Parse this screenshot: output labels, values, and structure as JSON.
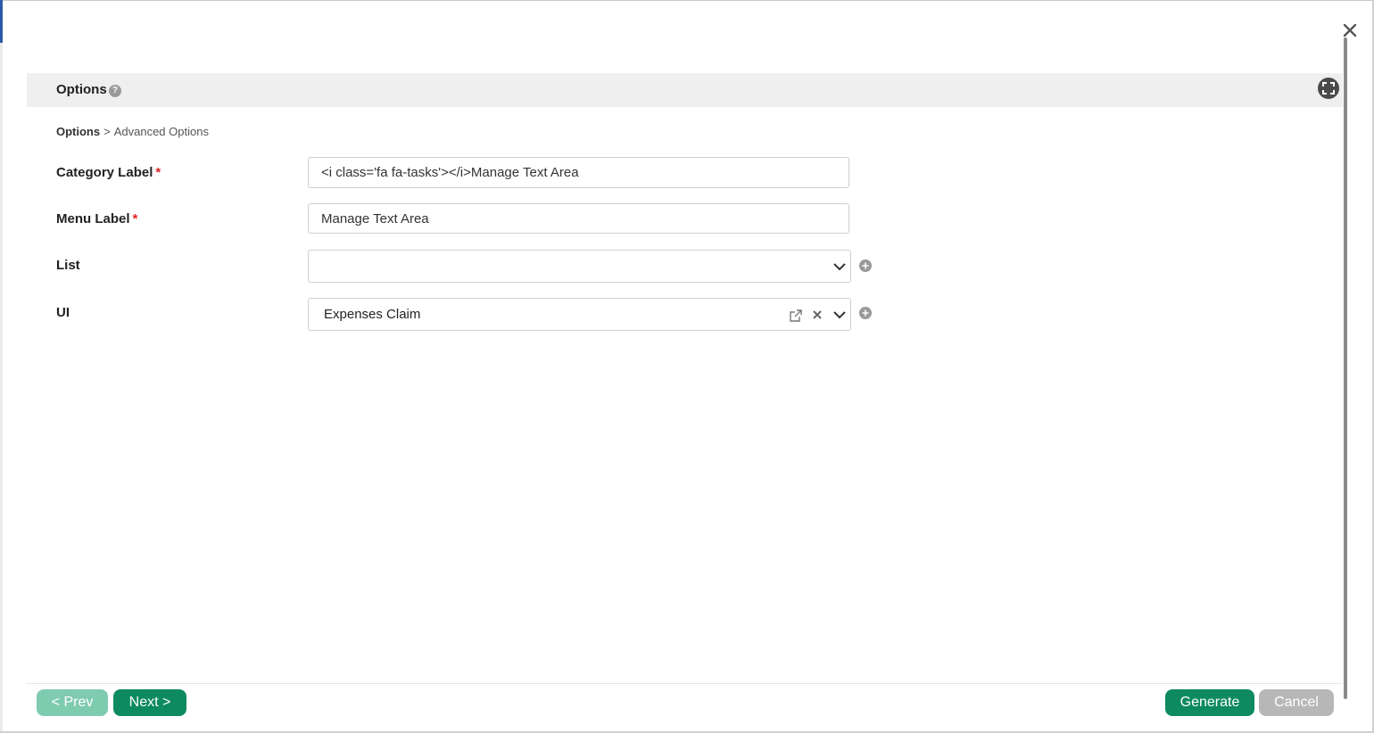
{
  "dialog": {
    "close_icon": "close-icon"
  },
  "header": {
    "title": "Options",
    "help_icon": "?",
    "fullscreen_icon": "expand-icon"
  },
  "breadcrumb": {
    "root": "Options",
    "separator": ">",
    "current": "Advanced Options"
  },
  "form": {
    "category_label": {
      "label": "Category Label",
      "required_mark": "*",
      "value": "<i class='fa fa-tasks'></i>Manage Text Area"
    },
    "menu_label": {
      "label": "Menu Label",
      "required_mark": "*",
      "value": "Manage Text Area"
    },
    "list": {
      "label": "List",
      "value": ""
    },
    "ui": {
      "label": "UI",
      "value": "Expenses Claim"
    }
  },
  "footer": {
    "prev_label": "< Prev",
    "next_label": "Next >",
    "generate_label": "Generate",
    "cancel_label": "Cancel"
  },
  "colors": {
    "primary": "#0d8a5f",
    "primary_disabled": "#7fcbb0",
    "cancel": "#b7b7b7",
    "required": "#dd2222",
    "header_bg": "#efefef"
  }
}
